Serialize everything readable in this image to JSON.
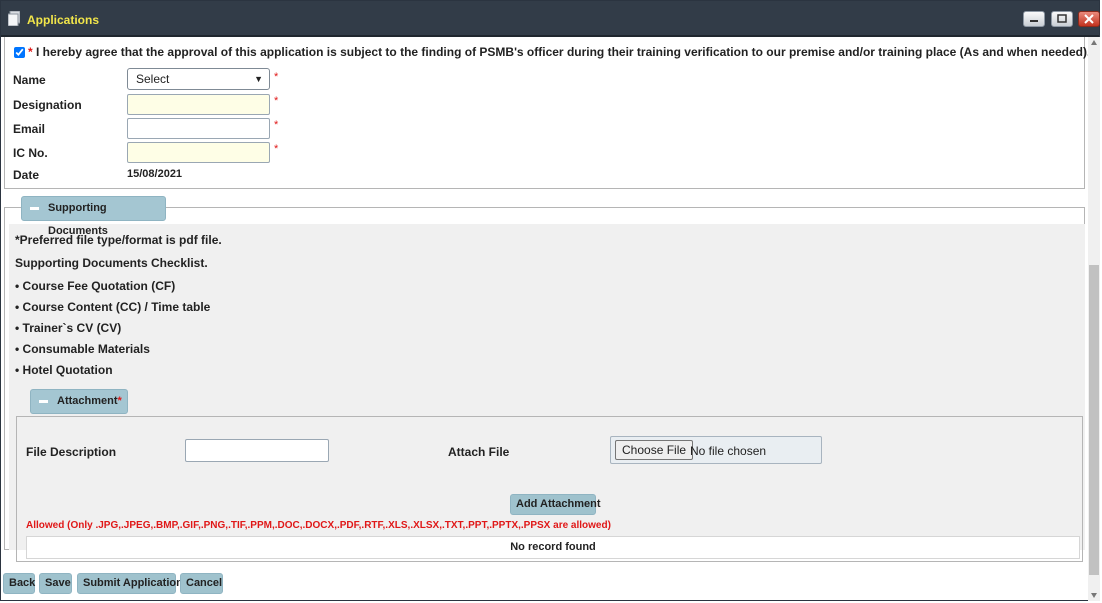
{
  "window": {
    "title": "Applications",
    "icon": "document-icon",
    "controls": [
      "minimize-icon",
      "restore-icon",
      "close-icon"
    ]
  },
  "agreement": {
    "checked": true,
    "required_mark": "*",
    "text": "I hereby agree that the approval of this application is subject to the finding of PSMB's officer during their training verification to our premise and/or training place (As and when needed)."
  },
  "form": {
    "name": {
      "label": "Name",
      "value": "Select",
      "required": "*"
    },
    "designation": {
      "label": "Designation",
      "value": "",
      "required": "*"
    },
    "email": {
      "label": "Email",
      "value": "",
      "required": "*"
    },
    "ic_no": {
      "label": "IC No.",
      "value": "",
      "required": "*"
    },
    "date": {
      "label": "Date",
      "value": "15/08/2021"
    }
  },
  "supporting_documents": {
    "legend": "Supporting Documents",
    "preferred": "*Preferred file type/format is pdf file.",
    "checklist_title": "Supporting Documents Checklist.",
    "checklist": [
      "• Course Fee Quotation (CF)",
      "• Course Content (CC) / Time table",
      "• Trainer`s CV (CV)",
      "• Consumable Materials",
      "• Hotel Quotation"
    ]
  },
  "attachment": {
    "legend": "Attachment",
    "required_mark": "*",
    "file_description_label": "File Description",
    "file_description_value": "",
    "attach_file_label": "Attach File",
    "choose_file_label": "Choose File",
    "no_file_text": "No file chosen",
    "add_button": "Add Attachment",
    "allowed_text": "Allowed (Only .JPG,.JPEG,.BMP,.GIF,.PNG,.TIF,.PPM,.DOC,.DOCX,.PDF,.RTF,.XLS,.XLSX,.TXT,.PPT,.PPTX,.PPSX are allowed)",
    "empty_table_text": "No record found"
  },
  "footer_buttons": {
    "back": "Back",
    "save": "Save",
    "submit": "Submit Application",
    "cancel": "Cancel"
  },
  "colors": {
    "titlebar": "#323c48",
    "title_text": "#f2e64a",
    "button_bg": "#9fc2cd",
    "required": "#e01818",
    "input_highlight": "#fefee6"
  }
}
